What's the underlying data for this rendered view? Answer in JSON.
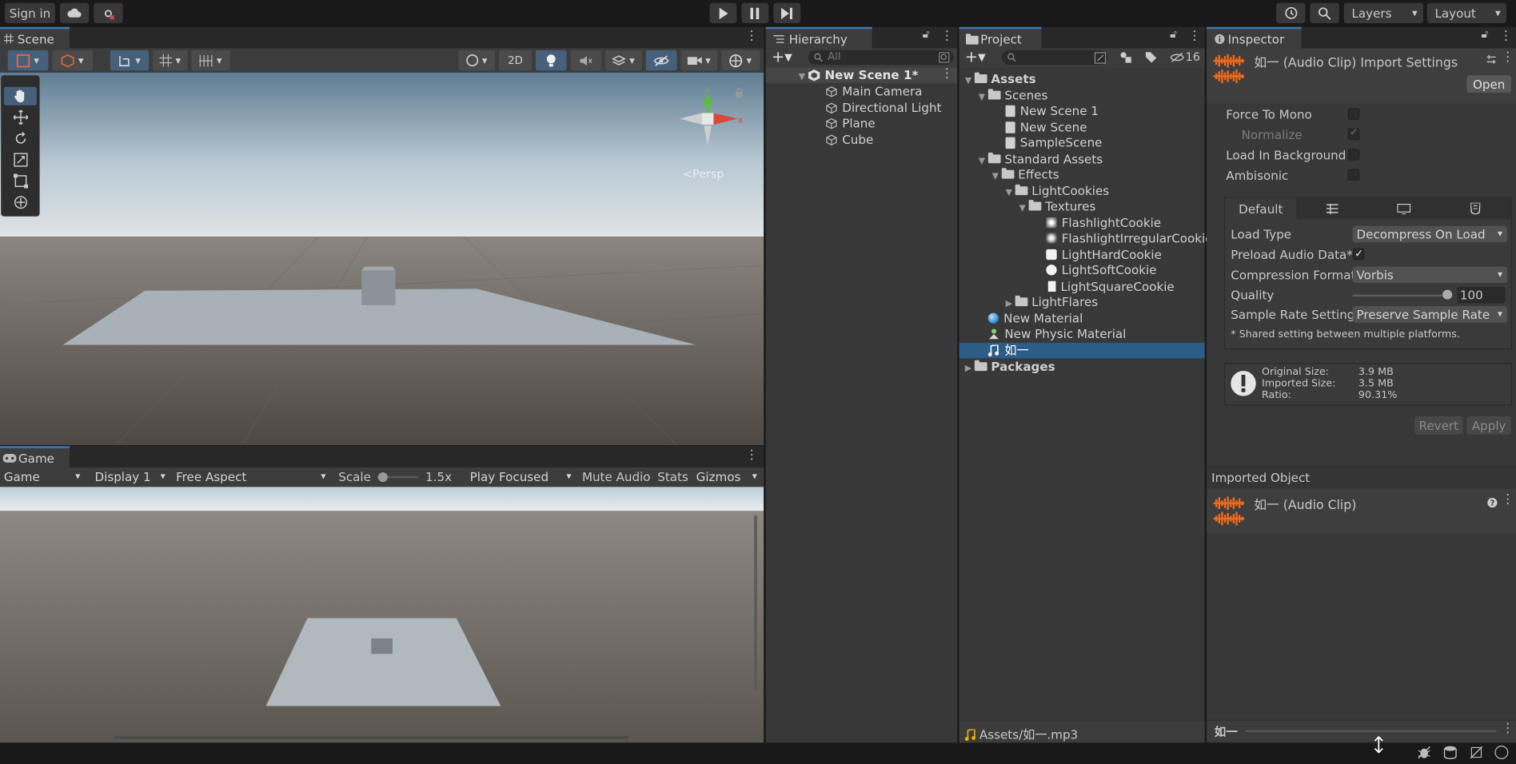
{
  "topbar": {
    "sign_in": "Sign in"
  },
  "layers_label": "Layers",
  "layout_label": "Layout",
  "scene": {
    "tab_label": "Scene",
    "btn_2d": "2D",
    "persp_label": "<Persp",
    "gizmo_y": "y",
    "gizmo_x": "x"
  },
  "game": {
    "tab_label": "Game",
    "view_dropdown": "Game",
    "display_dropdown": "Display 1",
    "aspect_dropdown": "Free Aspect",
    "scale_label": "Scale",
    "scale_value": "1.5x",
    "scale_fraction": 0.15,
    "play_mode_dropdown": "Play Focused",
    "mute_audio": "Mute Audio",
    "stats": "Stats",
    "gizmos": "Gizmos"
  },
  "hierarchy": {
    "tab_label": "Hierarchy",
    "search_placeholder": "All",
    "scene_name": "New Scene 1*",
    "items": [
      {
        "label": "Main Camera"
      },
      {
        "label": "Directional Light"
      },
      {
        "label": "Plane"
      },
      {
        "label": "Cube"
      }
    ]
  },
  "project": {
    "tab_label": "Project",
    "hidden_count": "16",
    "footer_path": "Assets/如一.mp3",
    "tree": {
      "assets": "Assets",
      "scenes": "Scenes",
      "scene_files": [
        {
          "label": "New Scene 1"
        },
        {
          "label": "New Scene"
        },
        {
          "label": "SampleScene"
        }
      ],
      "standard_assets": "Standard Assets",
      "effects": "Effects",
      "light_cookies": "LightCookies",
      "textures": "Textures",
      "texture_files": [
        {
          "label": "FlashlightCookie"
        },
        {
          "label": "FlashlightIrregularCookie"
        },
        {
          "label": "LightHardCookie"
        },
        {
          "label": "LightSoftCookie"
        },
        {
          "label": "LightSquareCookie"
        }
      ],
      "light_flares": "LightFlares",
      "new_material": "New Material",
      "new_physic_material": "New Physic Material",
      "audio_clip": "如一",
      "packages": "Packages"
    }
  },
  "inspector": {
    "tab_label": "Inspector",
    "title": "如一 (Audio Clip) Import Settings",
    "open_btn": "Open",
    "force_to_mono": "Force To Mono",
    "normalize": "Normalize",
    "load_in_background": "Load In Background",
    "ambisonic": "Ambisonic",
    "platform_default": "Default",
    "load_type_label": "Load Type",
    "load_type_value": "Decompress On Load",
    "preload_label": "Preload Audio Data*",
    "compression_label": "Compression Format",
    "compression_value": "Vorbis",
    "quality_label": "Quality",
    "quality_value": "100",
    "quality_fraction": 1.0,
    "sample_rate_label": "Sample Rate Setting",
    "sample_rate_value": "Preserve Sample Rate",
    "shared_note": "* Shared setting between multiple platforms.",
    "original_size_label": "Original Size:",
    "original_size_value": "3.9 MB",
    "imported_size_label": "Imported Size:",
    "imported_size_value": "3.5 MB",
    "ratio_label": "Ratio:",
    "ratio_value": "90.31%",
    "revert_btn": "Revert",
    "apply_btn": "Apply",
    "imported_object_header": "Imported Object",
    "imported_object_title": "如一 (Audio Clip)",
    "footer_name": "如一"
  },
  "colors": {
    "accent": "#3a79bb",
    "selection": "#2c5d87",
    "panel": "#383838",
    "sky": "#c7d3db",
    "ground": "#55504a"
  }
}
